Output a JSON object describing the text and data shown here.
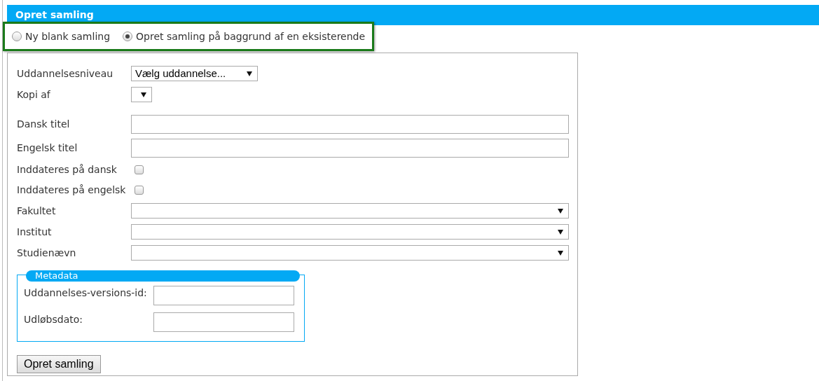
{
  "header": {
    "title": "Opret samling"
  },
  "mode_options": [
    {
      "label": "Ny blank samling",
      "selected": false
    },
    {
      "label": "Opret samling på baggrund af en eksisterende",
      "selected": true
    }
  ],
  "fields": [
    {
      "kind": "select",
      "label": "Uddannelsesniveau",
      "value": "Vælg uddannelse..."
    },
    {
      "kind": "select",
      "label": "Kopi af"
    },
    {
      "kind": "text",
      "label": "Dansk titel"
    },
    {
      "kind": "text",
      "label": "Engelsk titel"
    },
    {
      "kind": "checkbox",
      "label": "Inddateres på dansk",
      "checked": false
    },
    {
      "kind": "checkbox",
      "label": "Inddateres på engelsk",
      "checked": false
    },
    {
      "kind": "select",
      "label": "Fakultet"
    },
    {
      "kind": "select",
      "label": "Institut"
    },
    {
      "kind": "select",
      "label": "Studienævn"
    }
  ],
  "metadata": {
    "legend": "Metadata",
    "fields": [
      {
        "label": "Uddannelses-versions-id:"
      },
      {
        "label": "Udløbsdato:"
      }
    ]
  },
  "submit_button": "Opret samling"
}
